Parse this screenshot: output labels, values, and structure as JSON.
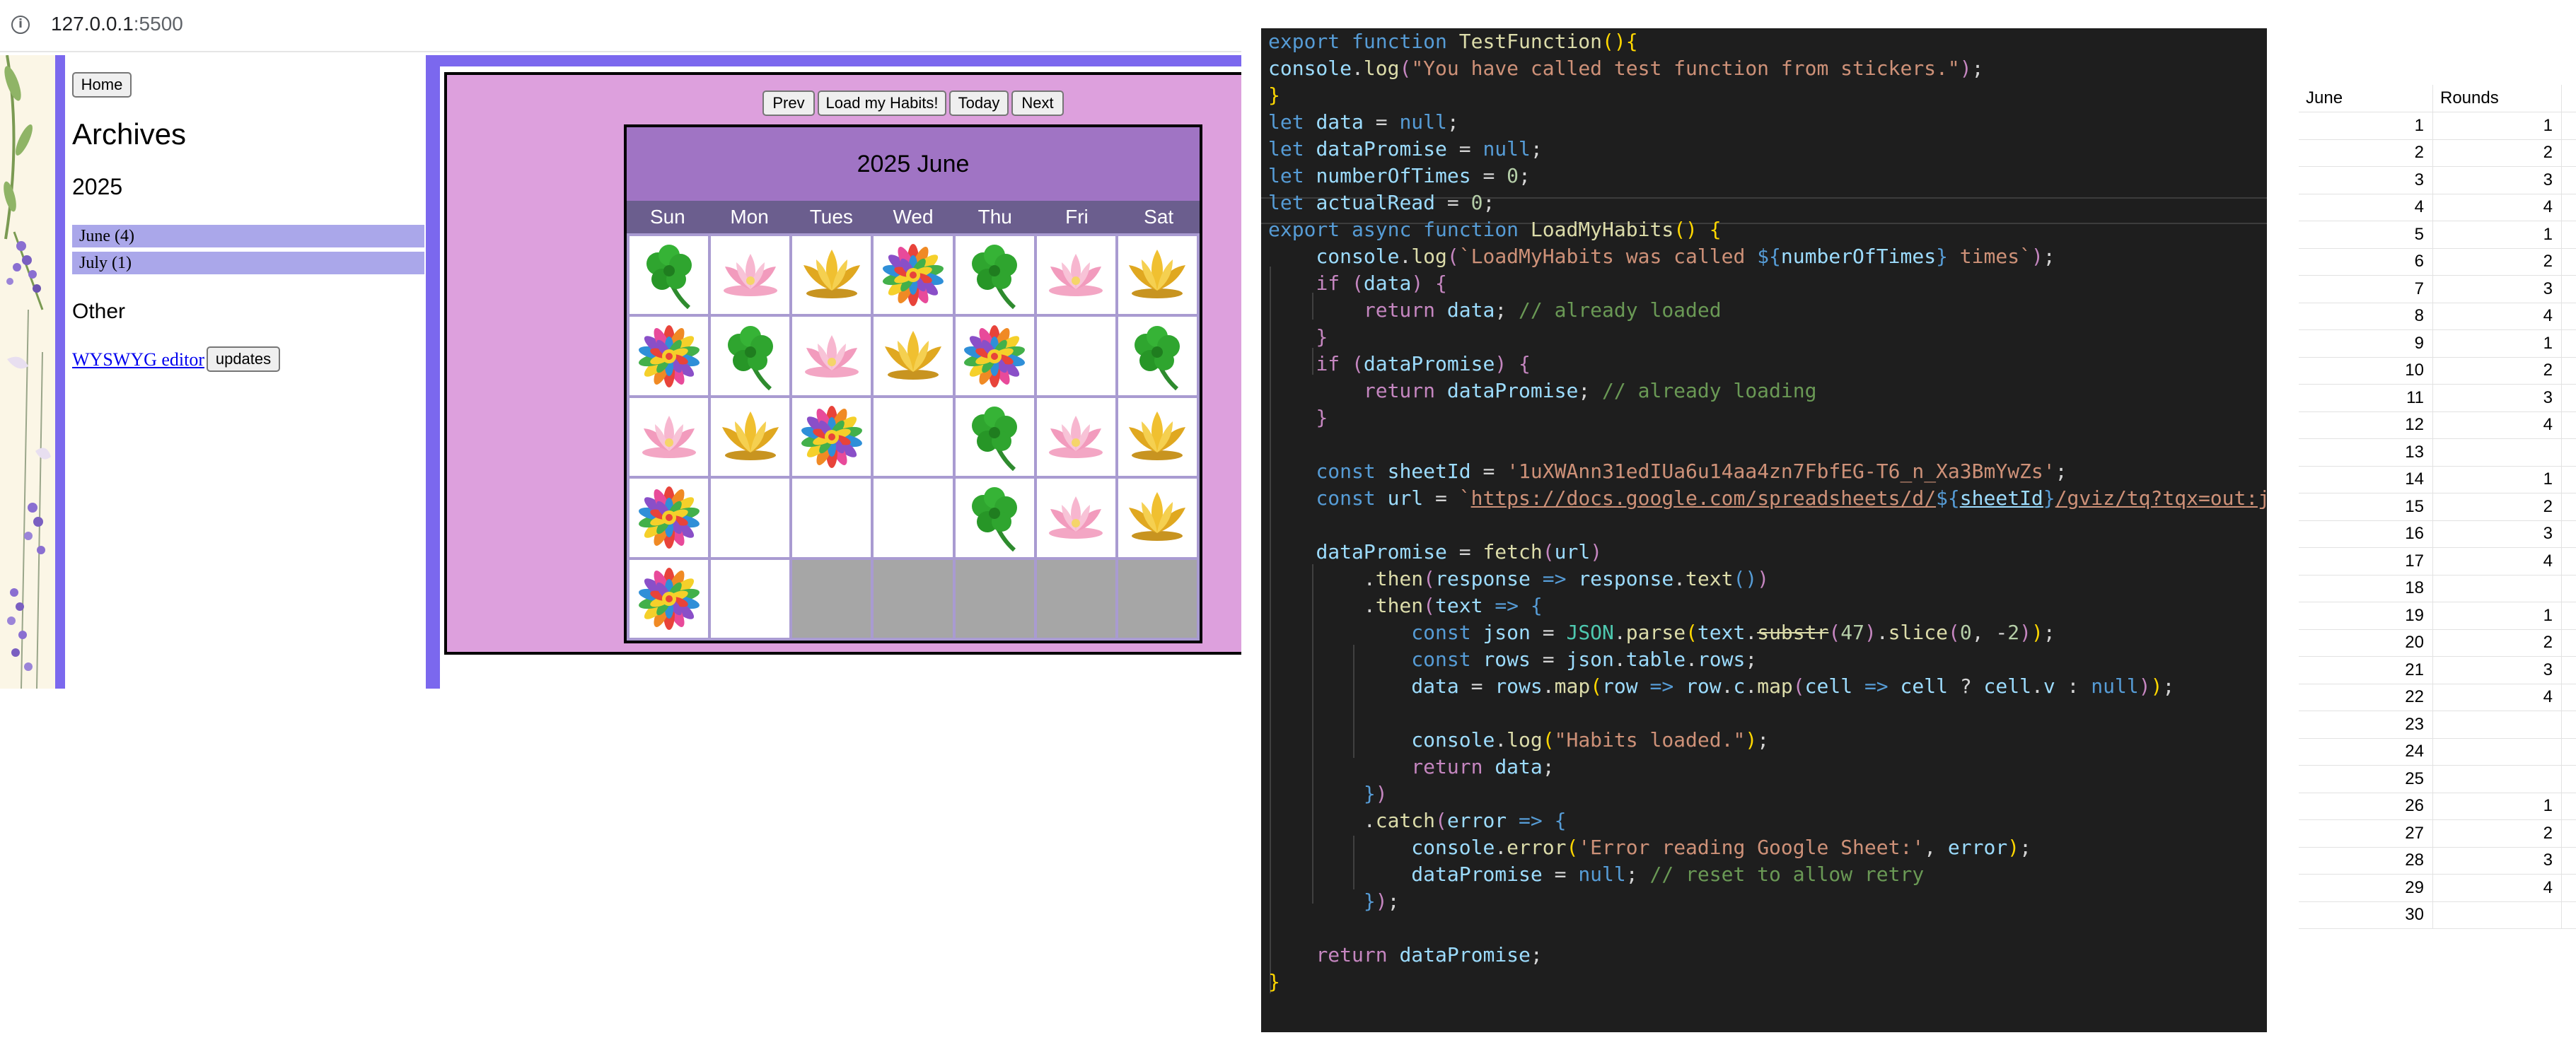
{
  "browser": {
    "url_host": "127.0.0.1",
    "url_port": ":5500"
  },
  "sidebar": {
    "home_label": "Home",
    "archives_title": "Archives",
    "year": "2025",
    "months": [
      {
        "label": "June (4)"
      },
      {
        "label": "July (1)"
      }
    ],
    "other_title": "Other",
    "wysiwyg_link": "WYSWYG editor",
    "updates_label": "updates"
  },
  "calendar": {
    "buttons": {
      "prev": "Prev",
      "load": "Load my Habits!",
      "today": "Today",
      "next": "Next"
    },
    "title": "2025 June",
    "days": [
      "Sun",
      "Mon",
      "Tues",
      "Wed",
      "Thu",
      "Fri",
      "Sat"
    ],
    "cells": [
      [
        "clover",
        "lotus",
        "gold-lotus",
        "mandala",
        "clover",
        "lotus",
        "gold-lotus"
      ],
      [
        "mandala",
        "clover",
        "lotus",
        "gold-lotus",
        "mandala",
        "",
        "clover"
      ],
      [
        "lotus",
        "gold-lotus",
        "mandala",
        "",
        "clover",
        "lotus",
        "gold-lotus"
      ],
      [
        "mandala",
        "",
        "",
        "",
        "clover",
        "lotus",
        "gold-lotus"
      ],
      [
        "mandala",
        "",
        "gray",
        "gray",
        "gray",
        "gray",
        "gray"
      ]
    ]
  },
  "editor": {
    "colors": {
      "background": "#1e1e1e",
      "keyword": "#569cd6",
      "string": "#ce9178",
      "comment": "#6a9955",
      "function": "#dcdcaa"
    },
    "lines": [
      "export function TestFunction(){",
      "console.log(\"You have called test function from stickers.\");",
      "}",
      "let data = null;",
      "let dataPromise = null;",
      "let numberOfTimes = 0;",
      "let actualRead = 0;",
      "export async function LoadMyHabits() {",
      "    console.log(`LoadMyHabits was called ${numberOfTimes} times`);",
      "    if (data) {",
      "        return data; // already loaded",
      "    }",
      "    if (dataPromise) {",
      "        return dataPromise; // already loading",
      "    }",
      "",
      "    const sheetId = '1uXWAnn31edIUa6u14aa4zn7FbfEG-T6_n_Xa3BmYwZs';",
      "    const url = `https://docs.google.com/spreadsheets/d/${sheetId}/gviz/tq?tqx=out:json`;",
      "",
      "    dataPromise = fetch(url)",
      "        .then(response => response.text())",
      "        .then(text => {",
      "            const json = JSON.parse(text.substr(47).slice(0, -2));",
      "            const rows = json.table.rows;",
      "            data = rows.map(row => row.c.map(cell => cell ? cell.v : null));",
      "",
      "            console.log(\"Habits loaded.\");",
      "            return data;",
      "        })",
      "        .catch(error => {",
      "            console.error('Error reading Google Sheet:', error);",
      "            dataPromise = null; // reset to allow retry",
      "        });",
      "",
      "    return dataPromise;",
      "}"
    ]
  },
  "sheet": {
    "headers": [
      "June",
      "Rounds"
    ],
    "rows": [
      [
        "1",
        "1"
      ],
      [
        "2",
        "2"
      ],
      [
        "3",
        "3"
      ],
      [
        "4",
        "4"
      ],
      [
        "5",
        "1"
      ],
      [
        "6",
        "2"
      ],
      [
        "7",
        "3"
      ],
      [
        "8",
        "4"
      ],
      [
        "9",
        "1"
      ],
      [
        "10",
        "2"
      ],
      [
        "11",
        "3"
      ],
      [
        "12",
        "4"
      ],
      [
        "13",
        ""
      ],
      [
        "14",
        "1"
      ],
      [
        "15",
        "2"
      ],
      [
        "16",
        "3"
      ],
      [
        "17",
        "4"
      ],
      [
        "18",
        ""
      ],
      [
        "19",
        "1"
      ],
      [
        "20",
        "2"
      ],
      [
        "21",
        "3"
      ],
      [
        "22",
        "4"
      ],
      [
        "23",
        ""
      ],
      [
        "24",
        ""
      ],
      [
        "25",
        ""
      ],
      [
        "26",
        "1"
      ],
      [
        "27",
        "2"
      ],
      [
        "28",
        "3"
      ],
      [
        "29",
        "4"
      ],
      [
        "30",
        ""
      ]
    ]
  }
}
